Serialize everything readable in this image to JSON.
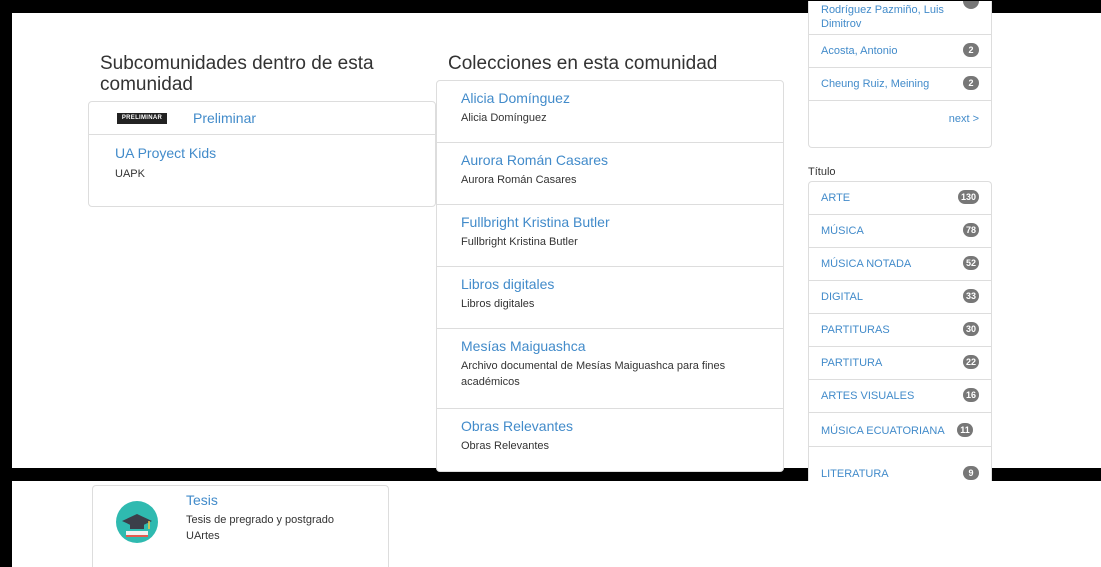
{
  "subcommunities": {
    "heading": "Subcomunidades dentro de esta comunidad",
    "items": [
      {
        "logo_text": "PRELIMINAR",
        "title": "Preliminar"
      },
      {
        "title": "UA Proyect Kids",
        "description": "UAPK"
      }
    ]
  },
  "collections": {
    "heading": "Colecciones en esta comunidad",
    "items": [
      {
        "title": "Alicia Domínguez",
        "description": "Alicia Domínguez"
      },
      {
        "title": "Aurora Román Casares",
        "description": "Aurora Román Casares"
      },
      {
        "title": "Fullbright Kristina Butler",
        "description": "Fullbright Kristina Butler"
      },
      {
        "title": "Libros digitales",
        "description": "Libros digitales"
      },
      {
        "title": "Mesías Maiguashca",
        "description": "Archivo documental de Mesías Maiguashca para fines académicos"
      },
      {
        "title": "Obras Relevantes",
        "description": "Obras Relevantes"
      }
    ]
  },
  "authors": {
    "items": [
      {
        "label": "Rodríguez Pazmiño, Luis Dimitrov",
        "count": ""
      },
      {
        "label": "Acosta, Antonio",
        "count": "2"
      },
      {
        "label": "Cheung Ruiz, Meining",
        "count": "2"
      }
    ],
    "next_label": "next >"
  },
  "titles": {
    "heading": "Título",
    "items": [
      {
        "label": "ARTE",
        "count": "130"
      },
      {
        "label": "MÚSICA",
        "count": "78"
      },
      {
        "label": "MÚSICA NOTADA",
        "count": "52"
      },
      {
        "label": "DIGITAL",
        "count": "33"
      },
      {
        "label": "PARTITURAS",
        "count": "30"
      },
      {
        "label": "PARTITURA",
        "count": "22"
      },
      {
        "label": "ARTES VISUALES",
        "count": "16"
      },
      {
        "label": "MÚSICA ECUATORIANA",
        "count": "11"
      },
      {
        "label": "LITERATURA",
        "count": "9"
      }
    ]
  },
  "bottom": {
    "title": "Tesis",
    "description": "Tesis de pregrado y postgrado",
    "subtitle": "UArtes"
  },
  "colors": {
    "link": "#428bca",
    "badge": "#777777",
    "border": "#dddddd"
  }
}
